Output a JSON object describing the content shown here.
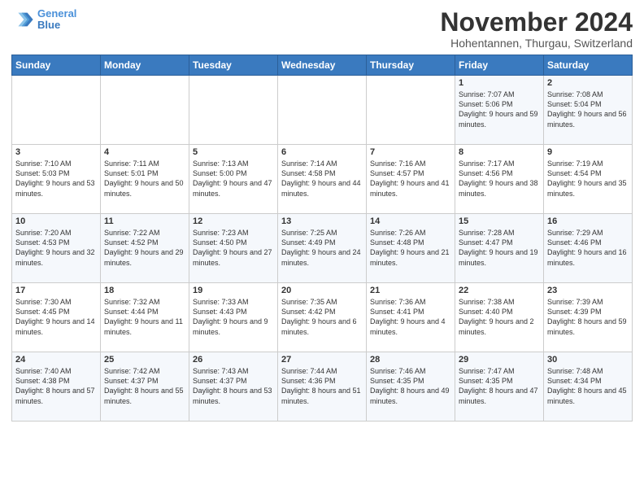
{
  "logo": {
    "line1": "General",
    "line2": "Blue"
  },
  "title": "November 2024",
  "location": "Hohentannen, Thurgau, Switzerland",
  "weekdays": [
    "Sunday",
    "Monday",
    "Tuesday",
    "Wednesday",
    "Thursday",
    "Friday",
    "Saturday"
  ],
  "weeks": [
    [
      {
        "day": "",
        "info": ""
      },
      {
        "day": "",
        "info": ""
      },
      {
        "day": "",
        "info": ""
      },
      {
        "day": "",
        "info": ""
      },
      {
        "day": "",
        "info": ""
      },
      {
        "day": "1",
        "info": "Sunrise: 7:07 AM\nSunset: 5:06 PM\nDaylight: 9 hours and 59 minutes."
      },
      {
        "day": "2",
        "info": "Sunrise: 7:08 AM\nSunset: 5:04 PM\nDaylight: 9 hours and 56 minutes."
      }
    ],
    [
      {
        "day": "3",
        "info": "Sunrise: 7:10 AM\nSunset: 5:03 PM\nDaylight: 9 hours and 53 minutes."
      },
      {
        "day": "4",
        "info": "Sunrise: 7:11 AM\nSunset: 5:01 PM\nDaylight: 9 hours and 50 minutes."
      },
      {
        "day": "5",
        "info": "Sunrise: 7:13 AM\nSunset: 5:00 PM\nDaylight: 9 hours and 47 minutes."
      },
      {
        "day": "6",
        "info": "Sunrise: 7:14 AM\nSunset: 4:58 PM\nDaylight: 9 hours and 44 minutes."
      },
      {
        "day": "7",
        "info": "Sunrise: 7:16 AM\nSunset: 4:57 PM\nDaylight: 9 hours and 41 minutes."
      },
      {
        "day": "8",
        "info": "Sunrise: 7:17 AM\nSunset: 4:56 PM\nDaylight: 9 hours and 38 minutes."
      },
      {
        "day": "9",
        "info": "Sunrise: 7:19 AM\nSunset: 4:54 PM\nDaylight: 9 hours and 35 minutes."
      }
    ],
    [
      {
        "day": "10",
        "info": "Sunrise: 7:20 AM\nSunset: 4:53 PM\nDaylight: 9 hours and 32 minutes."
      },
      {
        "day": "11",
        "info": "Sunrise: 7:22 AM\nSunset: 4:52 PM\nDaylight: 9 hours and 29 minutes."
      },
      {
        "day": "12",
        "info": "Sunrise: 7:23 AM\nSunset: 4:50 PM\nDaylight: 9 hours and 27 minutes."
      },
      {
        "day": "13",
        "info": "Sunrise: 7:25 AM\nSunset: 4:49 PM\nDaylight: 9 hours and 24 minutes."
      },
      {
        "day": "14",
        "info": "Sunrise: 7:26 AM\nSunset: 4:48 PM\nDaylight: 9 hours and 21 minutes."
      },
      {
        "day": "15",
        "info": "Sunrise: 7:28 AM\nSunset: 4:47 PM\nDaylight: 9 hours and 19 minutes."
      },
      {
        "day": "16",
        "info": "Sunrise: 7:29 AM\nSunset: 4:46 PM\nDaylight: 9 hours and 16 minutes."
      }
    ],
    [
      {
        "day": "17",
        "info": "Sunrise: 7:30 AM\nSunset: 4:45 PM\nDaylight: 9 hours and 14 minutes."
      },
      {
        "day": "18",
        "info": "Sunrise: 7:32 AM\nSunset: 4:44 PM\nDaylight: 9 hours and 11 minutes."
      },
      {
        "day": "19",
        "info": "Sunrise: 7:33 AM\nSunset: 4:43 PM\nDaylight: 9 hours and 9 minutes."
      },
      {
        "day": "20",
        "info": "Sunrise: 7:35 AM\nSunset: 4:42 PM\nDaylight: 9 hours and 6 minutes."
      },
      {
        "day": "21",
        "info": "Sunrise: 7:36 AM\nSunset: 4:41 PM\nDaylight: 9 hours and 4 minutes."
      },
      {
        "day": "22",
        "info": "Sunrise: 7:38 AM\nSunset: 4:40 PM\nDaylight: 9 hours and 2 minutes."
      },
      {
        "day": "23",
        "info": "Sunrise: 7:39 AM\nSunset: 4:39 PM\nDaylight: 8 hours and 59 minutes."
      }
    ],
    [
      {
        "day": "24",
        "info": "Sunrise: 7:40 AM\nSunset: 4:38 PM\nDaylight: 8 hours and 57 minutes."
      },
      {
        "day": "25",
        "info": "Sunrise: 7:42 AM\nSunset: 4:37 PM\nDaylight: 8 hours and 55 minutes."
      },
      {
        "day": "26",
        "info": "Sunrise: 7:43 AM\nSunset: 4:37 PM\nDaylight: 8 hours and 53 minutes."
      },
      {
        "day": "27",
        "info": "Sunrise: 7:44 AM\nSunset: 4:36 PM\nDaylight: 8 hours and 51 minutes."
      },
      {
        "day": "28",
        "info": "Sunrise: 7:46 AM\nSunset: 4:35 PM\nDaylight: 8 hours and 49 minutes."
      },
      {
        "day": "29",
        "info": "Sunrise: 7:47 AM\nSunset: 4:35 PM\nDaylight: 8 hours and 47 minutes."
      },
      {
        "day": "30",
        "info": "Sunrise: 7:48 AM\nSunset: 4:34 PM\nDaylight: 8 hours and 45 minutes."
      }
    ]
  ]
}
